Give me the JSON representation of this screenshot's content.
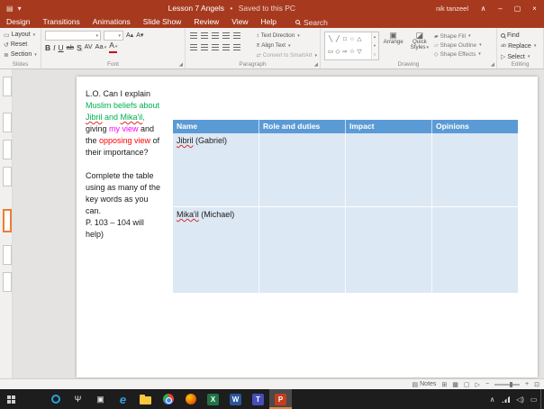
{
  "colors": {
    "black": "#1a1a1a",
    "green": "#00b050",
    "magenta": "#ff00ff",
    "red": "#ff0000",
    "titlebar_red": "#a73a1e",
    "table_header_blue": "#5b9bd5",
    "table_body_blue": "#dce8f4",
    "selected_thumb_orange": "#ed7d31",
    "taskbar_dark": "#1d1d1d"
  },
  "icons": {
    "save": "▤",
    "dropdown": "▾",
    "ribbon_display": "∧",
    "minimize": "–",
    "restore": "▢",
    "close": "×",
    "layout": "▭",
    "reset": "↺",
    "section": "≣",
    "grow_font": "A▴",
    "shrink_font": "A▾",
    "text_direction": "↕",
    "align_text": "≡",
    "smartart": "⇄",
    "arrange": "▣",
    "quick_styles": "◪",
    "shape_fill": "▰",
    "shape_outline": "▱",
    "shape_effects": "◇",
    "find": "⌕",
    "replace": "ab",
    "select": "▷",
    "notes": "▤",
    "view_normal": "⊞",
    "view_sorter": "▦",
    "view_reading": "▢",
    "view_slideshow": "▷",
    "zoom_out": "−",
    "zoom_in": "+",
    "fit_window": "⊡",
    "gallery_up": "▴",
    "gallery_down": "▾",
    "gallery_more": "▿"
  },
  "titlebar": {
    "title": "Lesson 7 Angels",
    "separator": "•",
    "saved_status": "Saved to this PC",
    "user": "nik tanzeel"
  },
  "tabs": [
    "Design",
    "Transitions",
    "Animations",
    "Slide Show",
    "Review",
    "View",
    "Help"
  ],
  "search_label": "Search",
  "ribbon": {
    "slides": {
      "label": "Slides",
      "layout": "Layout",
      "reset": "Reset",
      "section": "Section"
    },
    "font": {
      "label": "Font",
      "bold": "B",
      "italic": "I",
      "underline": "U",
      "strikethrough": "ab",
      "shadow": "S",
      "spacing": "AV",
      "case": "Aa",
      "font_color": "A"
    },
    "paragraph": {
      "label": "Paragraph",
      "text_direction": "Text Direction",
      "align_text": "Align Text",
      "smartart": "Convert to SmartArt"
    },
    "drawing": {
      "label": "Drawing",
      "arrange": "Arrange",
      "quick_styles": "Quick Styles",
      "shape_fill": "Shape Fill",
      "shape_outline": "Shape Outline",
      "shape_effects": "Shape Effects",
      "shapes": [
        "╲",
        "╱",
        "□",
        "○",
        "△",
        "▭",
        "◇",
        "⇨",
        "☆",
        "▽",
        "○",
        "╳"
      ]
    },
    "editing": {
      "label": "Editing",
      "find": "Find",
      "replace": "Replace",
      "select": "Select"
    }
  },
  "slide": {
    "text_lines": [
      [
        {
          "t": "L.O. Can I explain",
          "c": "black"
        }
      ],
      [
        {
          "t": "Muslim beliefs about",
          "c": "green"
        }
      ],
      [
        {
          "t": "Jibril",
          "c": "green",
          "misspelled": true
        },
        {
          "t": " and ",
          "c": "green"
        },
        {
          "t": "Mika'il",
          "c": "green",
          "misspelled": true
        },
        {
          "t": ",",
          "c": "green"
        }
      ],
      [
        {
          "t": "giving ",
          "c": "black"
        },
        {
          "t": "my view",
          "c": "magenta"
        },
        {
          "t": " and",
          "c": "black"
        }
      ],
      [
        {
          "t": "the ",
          "c": "black"
        },
        {
          "t": "opposing view",
          "c": "red"
        },
        {
          "t": " of",
          "c": "black"
        }
      ],
      [
        {
          "t": "their importance?",
          "c": "black"
        }
      ],
      [],
      [
        {
          "t": "Complete the table",
          "c": "black"
        }
      ],
      [
        {
          "t": "using as many of the",
          "c": "black"
        }
      ],
      [
        {
          "t": "key words as you",
          "c": "black"
        }
      ],
      [
        {
          "t": "can.",
          "c": "black"
        }
      ],
      [
        {
          "t": "P. 103 – 104 will",
          "c": "black"
        }
      ],
      [
        {
          "t": "help)",
          "c": "black"
        }
      ]
    ],
    "table": {
      "headers": [
        "Name",
        "Role and duties",
        "Impact",
        "Opinions"
      ],
      "rows": [
        {
          "name_segments": [
            {
              "t": "Jibril",
              "misspelled": true
            },
            {
              "t": " (Gabriel)"
            }
          ],
          "cells": [
            "",
            "",
            ""
          ]
        },
        {
          "name_segments": [
            {
              "t": "Mika'il",
              "misspelled": true
            },
            {
              "t": " (Michael)"
            }
          ],
          "cells": [
            "",
            "",
            ""
          ]
        }
      ]
    }
  },
  "statusbar": {
    "notes": "Notes"
  },
  "taskbar": {
    "apps": [
      {
        "name": "start-button",
        "cls": "ic-start"
      },
      {
        "name": "cortana-search-button",
        "cls": "ic-ring"
      },
      {
        "name": "microphone-icon",
        "glyph": "Ψ",
        "cls": "ic-glyph"
      },
      {
        "name": "task-view-icon",
        "glyph": "▣",
        "cls": "ic-glyph"
      },
      {
        "name": "edge-icon",
        "glyph": "e",
        "cls": "ic-edge",
        "fg": "#35a2e2"
      },
      {
        "name": "file-explorer-icon",
        "cls": "ic-folder"
      },
      {
        "name": "chrome-icon",
        "cls": "ic-chrome"
      },
      {
        "name": "firefox-icon",
        "cls": "ic-firefox"
      },
      {
        "name": "excel-icon",
        "glyph": "X",
        "cls": "ic-app",
        "bg": "#217346",
        "fg": "#ffffff"
      },
      {
        "name": "word-icon",
        "glyph": "W",
        "cls": "ic-app",
        "bg": "#2b579a",
        "fg": "#ffffff"
      },
      {
        "name": "teams-icon",
        "glyph": "T",
        "cls": "ic-app",
        "bg": "#464eb8",
        "fg": "#ffffff"
      },
      {
        "name": "powerpoint-icon",
        "glyph": "P",
        "cls": "ic-app",
        "bg": "#c43e1c",
        "fg": "#ffffff",
        "active": true
      }
    ],
    "tray": [
      {
        "name": "tray-expand-icon",
        "glyph": "∧"
      },
      {
        "name": "network-icon",
        "cls": "ic-net"
      },
      {
        "name": "volume-icon",
        "glyph": "◁)"
      },
      {
        "name": "action-center-icon",
        "glyph": "▭"
      }
    ]
  }
}
